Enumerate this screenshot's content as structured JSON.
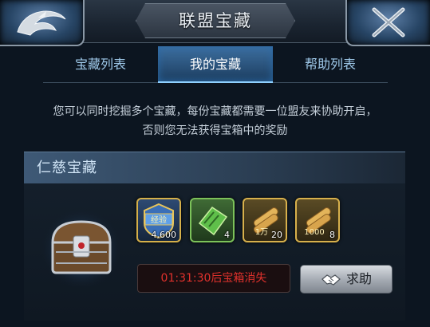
{
  "header": {
    "title": "联盟宝藏",
    "logo_icon": "dragon-emblem-icon",
    "close_icon": "close-icon"
  },
  "tabs": [
    {
      "label": "宝藏列表",
      "active": false
    },
    {
      "label": "我的宝藏",
      "active": true
    },
    {
      "label": "帮助列表",
      "active": false
    }
  ],
  "description": {
    "line1": "您可以同时挖掘多个宝藏，每份宝藏都需要一位盟友来协助开启，",
    "line2": "否则您无法获得宝箱中的奖励"
  },
  "treasure": {
    "name": "仁慈宝藏",
    "chest_icon": "treasure-chest-icon",
    "rewards": [
      {
        "icon": "experience-badge-icon",
        "badge_text": "经验",
        "qty": "4,600"
      },
      {
        "icon": "green-scroll-icon",
        "qty": "4"
      },
      {
        "icon": "lumber-icon",
        "badge_text": "1万",
        "qty": "20"
      },
      {
        "icon": "lumber-icon",
        "badge_text": "1000",
        "qty": "8"
      }
    ],
    "timer_text": "01:31:30后宝箱消失",
    "help_label": "求助",
    "help_icon": "handshake-icon"
  },
  "colors": {
    "accent": "#8fd0ff",
    "timer": "#e0312c",
    "gold_border": "#c9a54a"
  }
}
